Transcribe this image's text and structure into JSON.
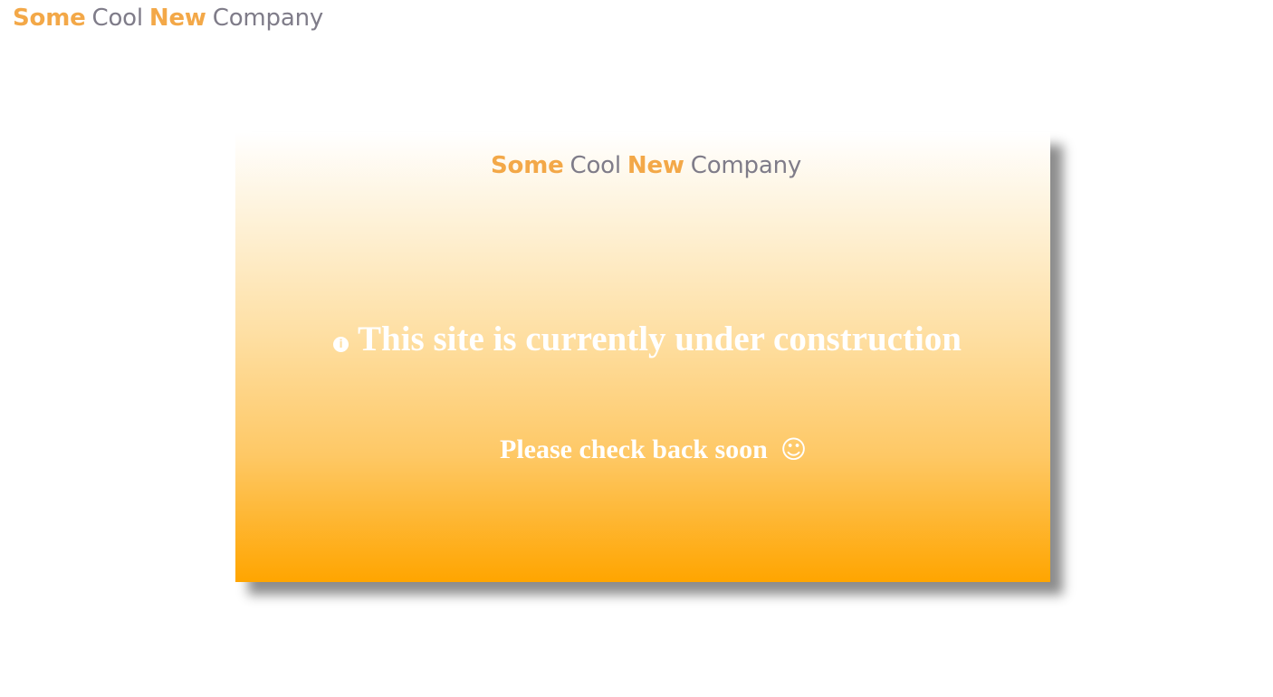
{
  "brand": {
    "word1": "Some",
    "word2": "Cool",
    "word3": "New",
    "word4": "Company",
    "accent_color": "#f3a848",
    "text_color": "#7f7c89"
  },
  "notice": {
    "icon": "info-circle-icon",
    "icon_glyph": "i",
    "headline": "This site is currently under construction",
    "subline": "Please check back soon",
    "smile_icon": "smiley-face-icon",
    "smile_glyph": "☺"
  },
  "colors": {
    "gradient_top": "#ffffff",
    "gradient_bottom": "#ffa500",
    "notice_text": "#ffffff"
  }
}
